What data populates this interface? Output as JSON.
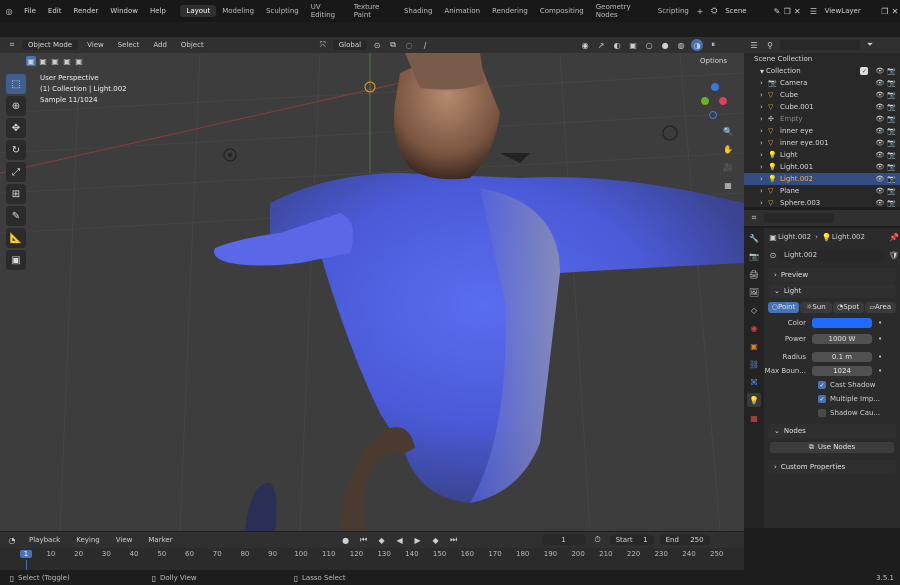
{
  "menubar": {
    "menus": [
      "File",
      "Edit",
      "Render",
      "Window",
      "Help"
    ],
    "workspaces": [
      "Layout",
      "Modeling",
      "Sculpting",
      "UV Editing",
      "Texture Paint",
      "Shading",
      "Animation",
      "Rendering",
      "Compositing",
      "Geometry Nodes",
      "Scripting"
    ],
    "active_workspace": "Layout",
    "scene": "Scene",
    "view_layer": "ViewLayer"
  },
  "viewport_header": {
    "mode": "Object Mode",
    "menus": [
      "View",
      "Select",
      "Add",
      "Object"
    ],
    "orientation": "Global",
    "options": "Options"
  },
  "viewport_info": {
    "line1": "User Perspective",
    "line2": "(1) Collection | Light.002",
    "line3": "Sample 11/1024"
  },
  "outliner": {
    "title": "Scene Collection",
    "collection": "Collection",
    "items": [
      {
        "name": "Camera",
        "type": "camera",
        "selected": false
      },
      {
        "name": "Cube",
        "type": "mesh",
        "selected": false
      },
      {
        "name": "Cube.001",
        "type": "mesh",
        "selected": false
      },
      {
        "name": "Empty",
        "type": "empty",
        "selected": false
      },
      {
        "name": "inner eye",
        "type": "mesh",
        "selected": false
      },
      {
        "name": "inner eye.001",
        "type": "mesh",
        "selected": false
      },
      {
        "name": "Light",
        "type": "light",
        "selected": false
      },
      {
        "name": "Light.001",
        "type": "light",
        "selected": false
      },
      {
        "name": "Light.002",
        "type": "light",
        "selected": true
      },
      {
        "name": "Plane",
        "type": "mesh",
        "selected": false
      },
      {
        "name": "Sphere.003",
        "type": "mesh",
        "selected": false
      }
    ]
  },
  "properties": {
    "breadcrumb_a": "Light.002",
    "breadcrumb_b": "Light.002",
    "datablock": "Light.002",
    "preview_label": "Preview",
    "light_label": "Light",
    "types": [
      "Point",
      "Sun",
      "Spot",
      "Area"
    ],
    "active_type": "Point",
    "color_label": "Color",
    "color_value": "#1f6bff",
    "power_label": "Power",
    "power_value": "1000 W",
    "radius_label": "Radius",
    "radius_value": "0.1 m",
    "max_bounces_label": "Max Boun...",
    "max_bounces_value": "1024",
    "cast_shadow": "Cast Shadow",
    "multiple_imp": "Multiple Imp...",
    "shadow_caustics": "Shadow Cau...",
    "nodes_label": "Nodes",
    "use_nodes": "Use Nodes",
    "custom_props": "Custom Properties"
  },
  "timeline": {
    "menus": [
      "Playback",
      "Keying",
      "View",
      "Marker"
    ],
    "current_frame": "1",
    "start_label": "Start",
    "start_value": "1",
    "end_label": "End",
    "end_value": "250",
    "ticks": [
      "1",
      "10",
      "20",
      "30",
      "40",
      "50",
      "60",
      "70",
      "80",
      "90",
      "100",
      "110",
      "120",
      "130",
      "140",
      "150",
      "160",
      "170",
      "180",
      "190",
      "200",
      "210",
      "220",
      "230",
      "240",
      "250"
    ]
  },
  "statusbar": {
    "select": "Select (Toggle)",
    "dolly": "Dolly View",
    "lasso": "Lasso Select",
    "version": "3.5.1"
  }
}
